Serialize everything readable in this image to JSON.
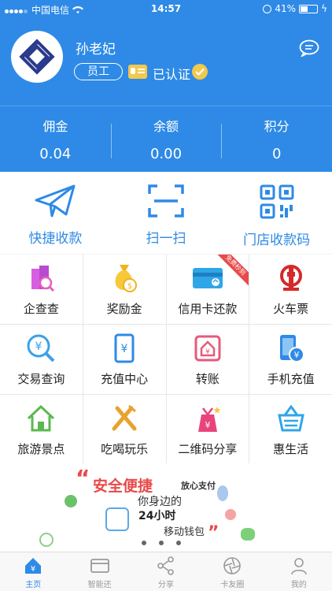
{
  "status_bar": {
    "carrier": "中国电信",
    "time": "14:57",
    "battery": "41%"
  },
  "profile": {
    "name": "孙老妃",
    "role": "员工",
    "verified": "已认证"
  },
  "stats": [
    {
      "label": "佣金",
      "value": "0.04"
    },
    {
      "label": "余额",
      "value": "0.00"
    },
    {
      "label": "积分",
      "value": "0"
    }
  ],
  "quick_actions": [
    {
      "label": "快捷收款",
      "icon": "paper-plane-icon"
    },
    {
      "label": "扫一扫",
      "icon": "scan-icon"
    },
    {
      "label": "门店收款码",
      "icon": "qrcode-icon"
    }
  ],
  "services": [
    {
      "label": "企查查",
      "icon": "building-search-icon"
    },
    {
      "label": "奖励金",
      "icon": "money-bag-icon"
    },
    {
      "label": "信用卡还款",
      "icon": "credit-card-icon",
      "badge": "免费秒到"
    },
    {
      "label": "火车票",
      "icon": "railway-icon"
    },
    {
      "label": "交易查询",
      "icon": "transaction-search-icon"
    },
    {
      "label": "充值中心",
      "icon": "phone-recharge-icon"
    },
    {
      "label": "转账",
      "icon": "transfer-icon"
    },
    {
      "label": "手机充值",
      "icon": "mobile-topup-icon"
    },
    {
      "label": "旅游景点",
      "icon": "house-icon"
    },
    {
      "label": "吃喝玩乐",
      "icon": "fork-knife-icon"
    },
    {
      "label": "二维码分享",
      "icon": "gift-bag-icon"
    },
    {
      "label": "惠生活",
      "icon": "basket-icon"
    }
  ],
  "banner": {
    "title": "安全便捷",
    "tag": "放心支付",
    "line1": "你身边的",
    "line2": "24小时",
    "line3": "移动钱包"
  },
  "tabs": [
    {
      "label": "主页",
      "icon": "home-yen-icon",
      "active": true
    },
    {
      "label": "智能还",
      "icon": "card-icon",
      "active": false
    },
    {
      "label": "分享",
      "icon": "share-icon",
      "active": false
    },
    {
      "label": "卡友圈",
      "icon": "aperture-icon",
      "active": false
    },
    {
      "label": "我的",
      "icon": "person-icon",
      "active": false
    }
  ],
  "colors": {
    "primary": "#2e8ae6",
    "accent": "#e84a4a",
    "gold": "#f2c94c"
  }
}
